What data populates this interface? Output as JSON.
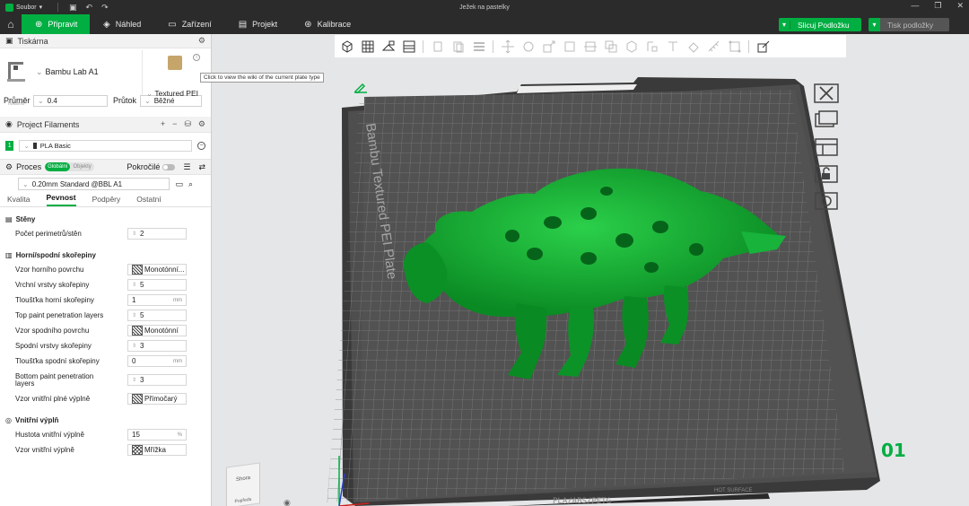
{
  "window": {
    "menu_label": "Soubor",
    "title": "Ježek na pastelky"
  },
  "tabs": [
    {
      "label": "Připravit",
      "icon": "plus-icon",
      "active": true
    },
    {
      "label": "Náhled",
      "icon": "layers-icon",
      "active": false
    },
    {
      "label": "Zařízení",
      "icon": "monitor-icon",
      "active": false
    },
    {
      "label": "Projekt",
      "icon": "folder-icon",
      "active": false
    },
    {
      "label": "Kalibrace",
      "icon": "target-icon",
      "active": false
    }
  ],
  "actions": {
    "slice_label": "Slicuj Podložku",
    "print_label": "Tisk podložky"
  },
  "printer": {
    "section_title": "Tiskárna",
    "small_label": "Tiskárna",
    "name": "Bambu Lab A1",
    "plate_name": "Textured PEI",
    "plate_tooltip": "Click to view the wiki of the current plate type",
    "nozzle_label": "Průměr",
    "nozzle_value": "0.4",
    "flow_label": "Průtok",
    "flow_value": "Běžné"
  },
  "filaments": {
    "section_title": "Project Filaments",
    "items": [
      {
        "index": "1",
        "name": "PLA Basic",
        "color": "#00ae42"
      }
    ]
  },
  "process": {
    "title": "Proces",
    "seg_global": "Globální",
    "seg_objects": "Objekty",
    "advanced_label": "Pokročilé",
    "profile": "0.20mm Standard @BBL A1",
    "tabs": [
      {
        "label": "Kvalita",
        "active": false
      },
      {
        "label": "Pevnost",
        "active": true
      },
      {
        "label": "Podpěry",
        "active": false
      },
      {
        "label": "Ostatní",
        "active": false
      }
    ]
  },
  "settings": {
    "walls": {
      "title": "Stěny",
      "rows": [
        {
          "label": "Počet perimetrů/stěn",
          "value": "2"
        }
      ]
    },
    "shells": {
      "title": "Horní/spodní skořepiny",
      "rows": [
        {
          "label": "Vzor horního povrchu",
          "value": "Monotónní..."
        },
        {
          "label": "Vrchní vrstvy skořepiny",
          "value": "5"
        },
        {
          "label": "Tloušťka horní skořepiny",
          "value": "1",
          "unit": "mm"
        },
        {
          "label": "Top paint penetration layers",
          "value": "5"
        },
        {
          "label": "Vzor spodního povrchu",
          "value": "Monotónní"
        },
        {
          "label": "Spodní vrstvy skořepiny",
          "value": "3"
        },
        {
          "label": "Tloušťka spodní skořepiny",
          "value": "0",
          "unit": "mm"
        },
        {
          "label": "Bottom paint penetration layers",
          "value": "3"
        },
        {
          "label": "Vzor vnitřní plné výplně",
          "value": "Přímočarý"
        }
      ]
    },
    "infill": {
      "title": "Vnitřní výplň",
      "rows": [
        {
          "label": "Hustota vnitřní výplně",
          "value": "15",
          "unit": "%"
        },
        {
          "label": "Vzor vnitřní výplně",
          "value": "Mřížka"
        }
      ]
    }
  },
  "viewport": {
    "bed_label": "Bambu Textured PEI Plate",
    "plate_number": "01",
    "bed_strip": "PLA/ABS/PETG",
    "hot_surface": "HOT SURFACE",
    "cube_top": "Shora",
    "cube_front": "Popředu",
    "model_color": "#0fa22e"
  }
}
